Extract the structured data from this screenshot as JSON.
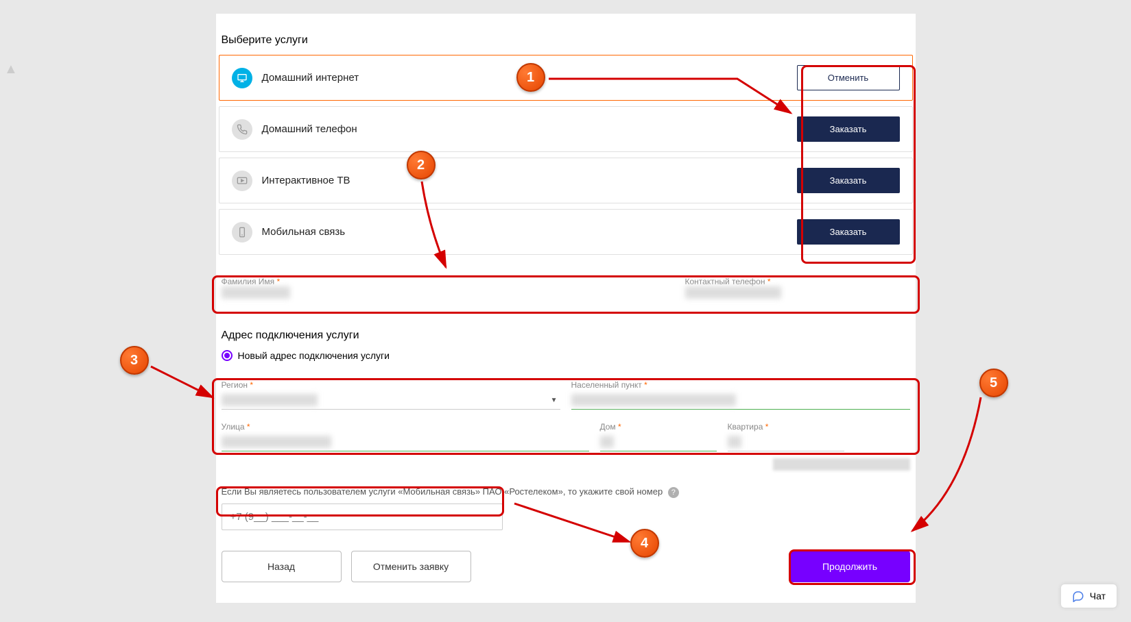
{
  "sectionTitle": "Выберите услуги",
  "services": [
    {
      "name": "Домашний интернет",
      "btn": "Отменить",
      "selected": true
    },
    {
      "name": "Домашний телефон",
      "btn": "Заказать",
      "selected": false
    },
    {
      "name": "Интерактивное ТВ",
      "btn": "Заказать",
      "selected": false
    },
    {
      "name": "Мобильная связь",
      "btn": "Заказать",
      "selected": false
    }
  ],
  "nameField": {
    "label": "Фамилия Имя",
    "req": "*"
  },
  "phoneField": {
    "label": "Контактный телефон",
    "req": "*"
  },
  "addressTitle": "Адрес подключения услуги",
  "radioLabel": "Новый адрес подключения услуги",
  "regionLabel": "Регион",
  "cityLabel": "Населенный пункт",
  "streetLabel": "Улица",
  "houseLabel": "Дом",
  "flatLabel": "Квартира",
  "flatHint": "При отсутствии квартиры укажите ноль",
  "mobileHint": "Если Вы являетесь пользователем услуги «Мобильная связь» ПАО «Ростелеком», то укажите свой номер",
  "phonePlaceholder": "+7 (9__) ___-__-__",
  "backBtn": "Назад",
  "cancelReqBtn": "Отменить заявку",
  "continueBtn": "Продолжить",
  "chat": "Чат",
  "req": "*",
  "markers": {
    "m1": "1",
    "m2": "2",
    "m3": "3",
    "m4": "4",
    "m5": "5"
  }
}
